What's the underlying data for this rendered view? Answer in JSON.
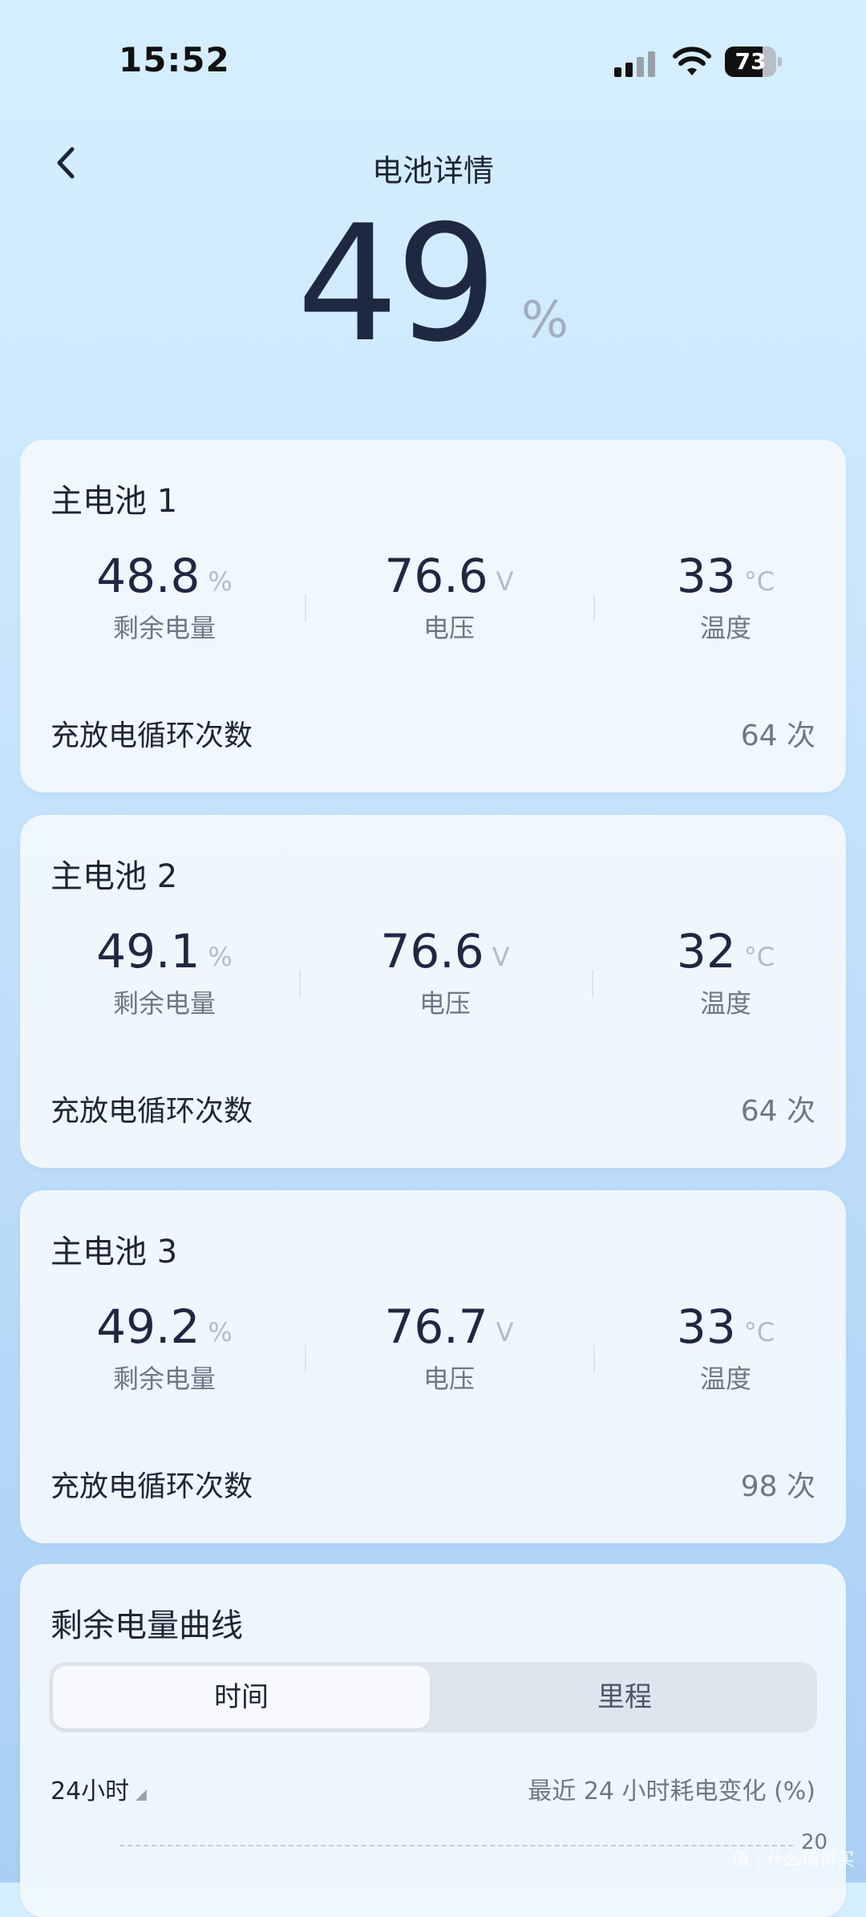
{
  "status_bar": {
    "time": "15:52",
    "battery_level": "73"
  },
  "header": {
    "title": "电池详情"
  },
  "summary": {
    "percent": "49",
    "unit": "%"
  },
  "batteries": [
    {
      "name": "主电池 1",
      "remaining": "48.8",
      "remaining_unit": "%",
      "remaining_label": "剩余电量",
      "voltage": "76.6",
      "voltage_unit": "V",
      "voltage_label": "电压",
      "temp": "33",
      "temp_unit": "°C",
      "temp_label": "温度",
      "cycle_label": "充放电循环次数",
      "cycle_value": "64 次"
    },
    {
      "name": "主电池 2",
      "remaining": "49.1",
      "remaining_unit": "%",
      "remaining_label": "剩余电量",
      "voltage": "76.6",
      "voltage_unit": "V",
      "voltage_label": "电压",
      "temp": "32",
      "temp_unit": "°C",
      "temp_label": "温度",
      "cycle_label": "充放电循环次数",
      "cycle_value": "64 次"
    },
    {
      "name": "主电池 3",
      "remaining": "49.2",
      "remaining_unit": "%",
      "remaining_label": "剩余电量",
      "voltage": "76.7",
      "voltage_unit": "V",
      "voltage_label": "电压",
      "temp": "33",
      "temp_unit": "°C",
      "temp_label": "温度",
      "cycle_label": "充放电循环次数",
      "cycle_value": "98 次"
    }
  ],
  "curve": {
    "title": "剩余电量曲线",
    "tabs": [
      "时间",
      "里程"
    ],
    "active_tab": "时间",
    "range_select": "24小时",
    "caption": "最近 24 小时耗电变化 (%)",
    "y_tick": "20"
  },
  "watermark": "值 | 什么值得买"
}
